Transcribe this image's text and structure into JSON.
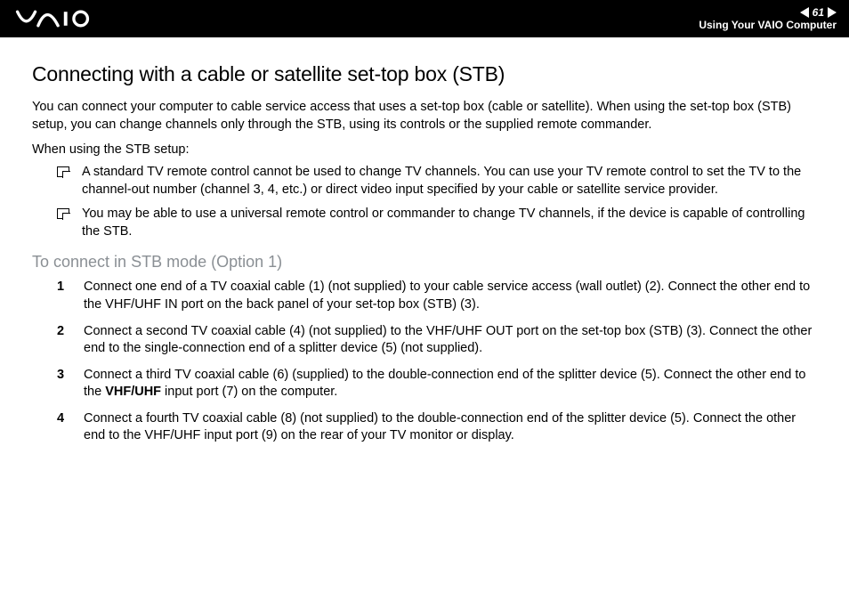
{
  "header": {
    "page_number": "61",
    "section": "Using Your VAIO Computer"
  },
  "title": "Connecting with a cable or satellite set-top box (STB)",
  "intro": "You can connect your computer to cable service access that uses a set-top box (cable or satellite). When using the set-top box (STB) setup, you can change channels only through the STB, using its controls or the supplied remote commander.",
  "lead": "When using the STB setup:",
  "bullets": [
    "A standard TV remote control cannot be used to change TV channels. You can use your TV remote control to set the TV to the channel-out number (channel 3, 4, etc.) or direct video input specified by your cable or satellite service provider.",
    "You may be able to use a universal remote control or commander to change TV channels, if the device is capable of controlling the STB."
  ],
  "subhead": "To connect in STB mode (Option 1)",
  "steps": [
    {
      "n": "1",
      "text": "Connect one end of a TV coaxial cable (1) (not supplied) to your cable service access (wall outlet) (2). Connect the other end to the VHF/UHF IN port on the back panel of your set-top box (STB) (3)."
    },
    {
      "n": "2",
      "text": "Connect a second TV coaxial cable (4) (not supplied) to the VHF/UHF OUT port on the set-top box (STB) (3). Connect the other end to the single-connection end of a splitter device (5) (not supplied)."
    },
    {
      "n": "3",
      "pre": "Connect a third TV coaxial cable (6) (supplied) to the double-connection end of the splitter device (5). Connect the other end to the ",
      "bold": "VHF/UHF",
      "post": " input port (7) on the computer."
    },
    {
      "n": "4",
      "text": "Connect a fourth TV coaxial cable (8) (not supplied) to the double-connection end of the splitter device (5). Connect the other end to the VHF/UHF input port (9) on the rear of your TV monitor or display."
    }
  ]
}
